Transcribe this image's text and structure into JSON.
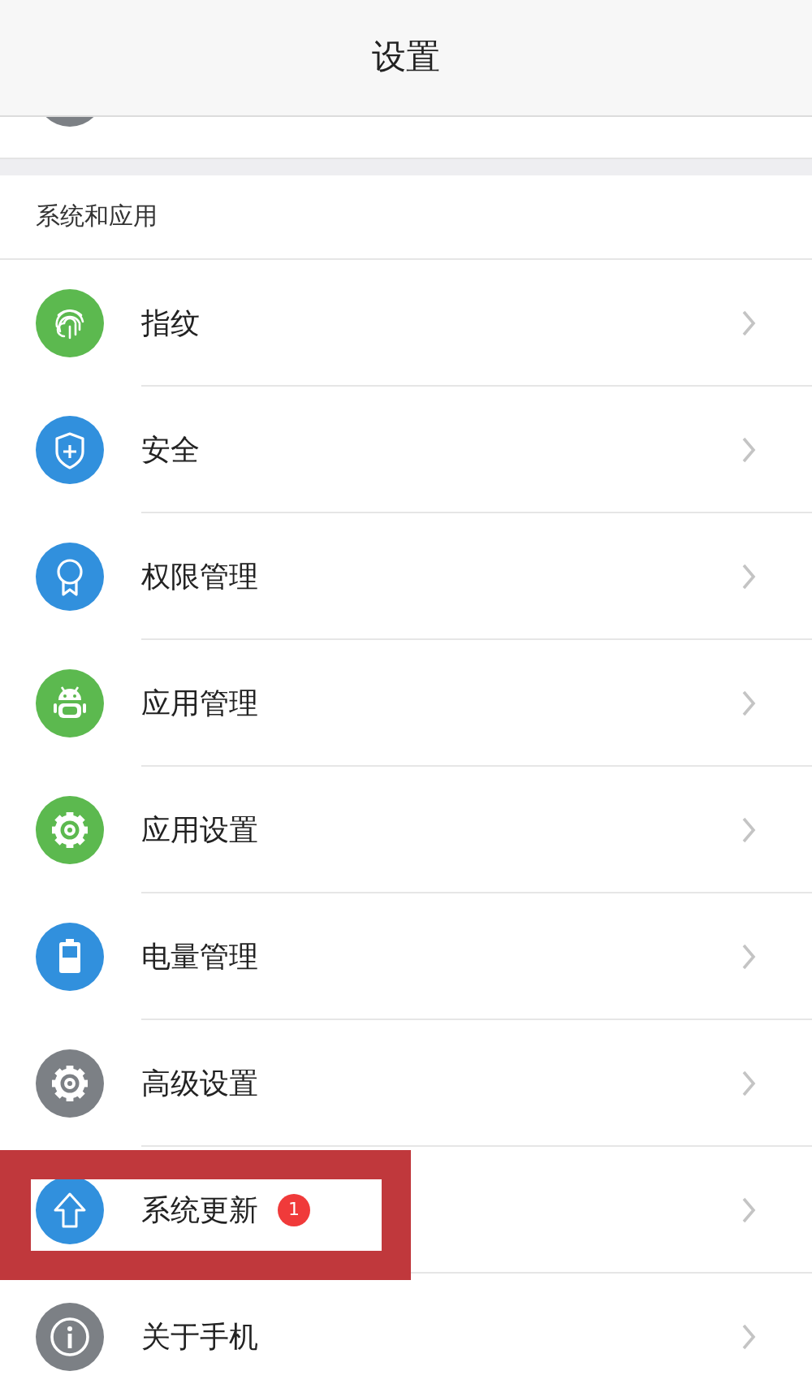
{
  "header": {
    "title": "设置"
  },
  "section": {
    "title": "系统和应用"
  },
  "items": [
    {
      "label": "指纹",
      "kind": "fingerprint",
      "color": "#5cb94f",
      "highlighted": false
    },
    {
      "label": "安全",
      "kind": "shield",
      "color": "#3190dd",
      "highlighted": false
    },
    {
      "label": "权限管理",
      "kind": "award",
      "color": "#3190dd",
      "highlighted": false
    },
    {
      "label": "应用管理",
      "kind": "android",
      "color": "#5cb94f",
      "highlighted": false
    },
    {
      "label": "应用设置",
      "kind": "gear",
      "color": "#5cb94f",
      "highlighted": false
    },
    {
      "label": "电量管理",
      "kind": "battery",
      "color": "#3190dd",
      "highlighted": false
    },
    {
      "label": "高级设置",
      "kind": "gear",
      "color": "#7c8085",
      "highlighted": false
    },
    {
      "label": "系统更新",
      "kind": "arrow-up",
      "color": "#3190dd",
      "highlighted": true,
      "badge": "1"
    },
    {
      "label": "关于手机",
      "kind": "info",
      "color": "#7c8085",
      "highlighted": false
    }
  ]
}
